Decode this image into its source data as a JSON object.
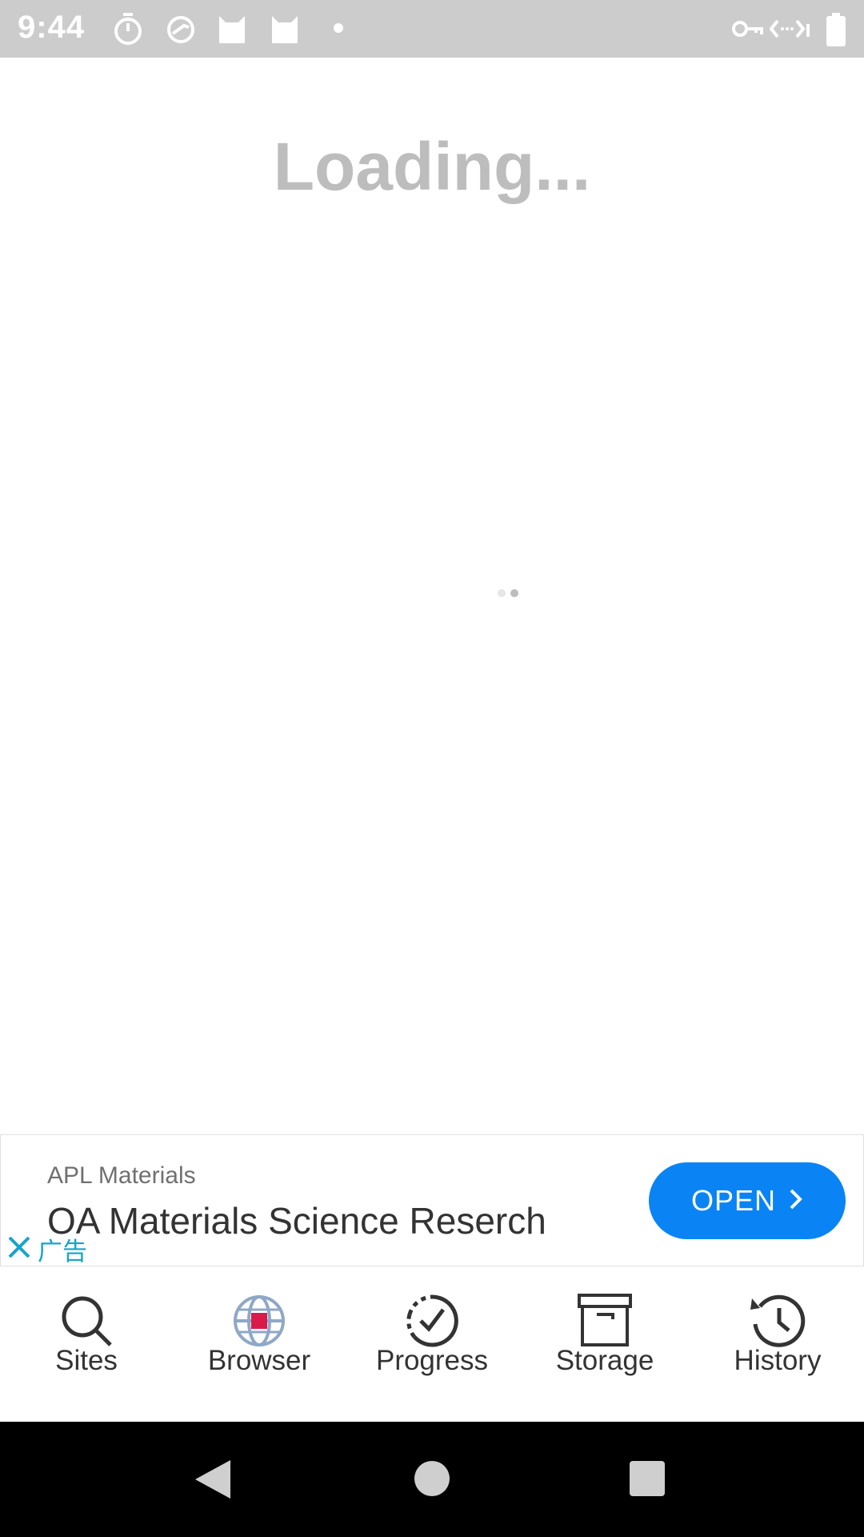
{
  "status_bar": {
    "time": "9:44",
    "left_icons": [
      "timer-icon",
      "speedometer-icon",
      "cat-icon",
      "cat-icon",
      "dot-icon"
    ],
    "right_icons": [
      "vpn-key-icon",
      "data-transfer-icon",
      "battery-icon"
    ]
  },
  "content": {
    "loading_text": "Loading...",
    "spinner_colors": [
      "#e6e6e6",
      "#bdbdbd"
    ]
  },
  "ad": {
    "advertiser": "APL Materials",
    "headline": "OA Materials Science Reserch",
    "cta_label": "OPEN",
    "ad_label": "广告",
    "accent_color": "#0a84f5",
    "label_color": "#1aa3c9"
  },
  "bottom_nav": {
    "items": [
      {
        "label": "Sites",
        "icon": "search-icon"
      },
      {
        "label": "Browser",
        "icon": "globe-icon"
      },
      {
        "label": "Progress",
        "icon": "progress-check-icon"
      },
      {
        "label": "Storage",
        "icon": "archive-box-icon"
      },
      {
        "label": "History",
        "icon": "history-icon"
      }
    ],
    "active_color": "#d81b4a"
  },
  "system_nav": {
    "buttons": [
      "back-button",
      "home-button",
      "recents-button"
    ]
  }
}
